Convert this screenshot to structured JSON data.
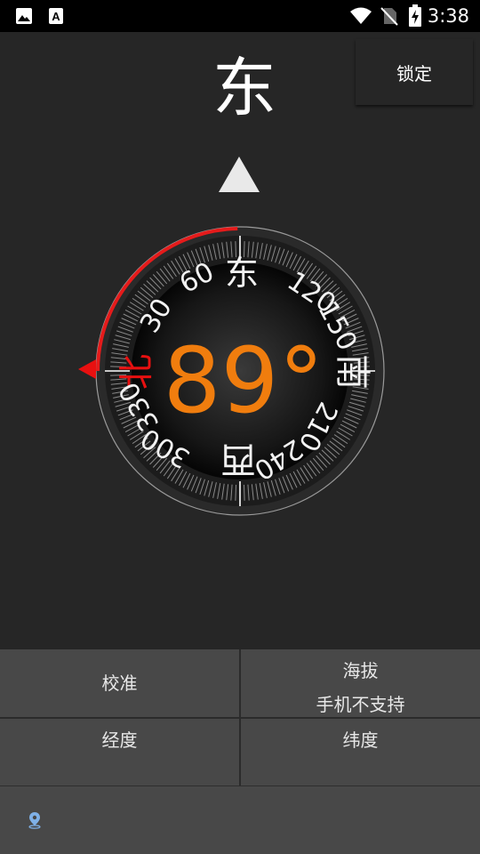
{
  "status_bar": {
    "time": "3:38",
    "icons": [
      "image-icon",
      "text-app-icon",
      "wifi-icon",
      "no-sim-icon",
      "battery-charging-icon"
    ]
  },
  "compass": {
    "heading_label": "东",
    "lock_label": "锁定",
    "degree_text": "89°",
    "heading_degrees": 89,
    "dial_labels": {
      "north": "北",
      "east": "东",
      "south": "南",
      "west": "西",
      "d30": "30",
      "d60": "60",
      "d120": "120",
      "d150": "150",
      "d210": "210",
      "d240": "240",
      "d300": "300",
      "d330": "330"
    },
    "colors": {
      "accent": "#f07d0e",
      "north": "#e81010",
      "arc": "#e51b1b"
    }
  },
  "panel": {
    "calibrate_label": "校准",
    "altitude_label": "海拔",
    "altitude_value": "手机不支持",
    "longitude_label": "经度",
    "latitude_label": "纬度",
    "location_icon": "location-pin-icon"
  }
}
